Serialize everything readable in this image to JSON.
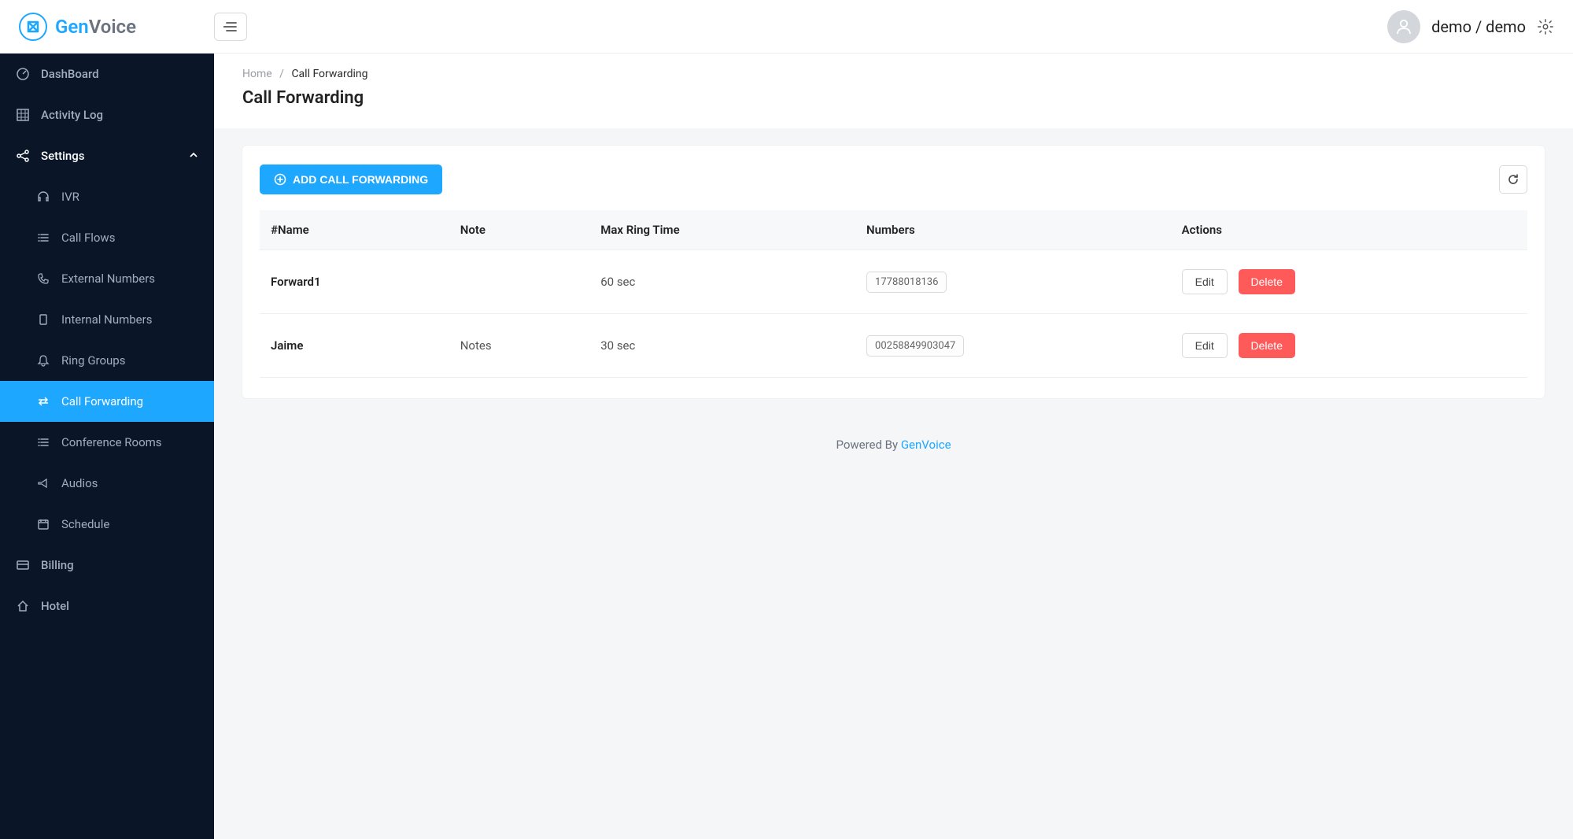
{
  "brand": {
    "part1": "Gen",
    "part2": "Voice"
  },
  "user": {
    "display": "demo / demo"
  },
  "sidebar": {
    "top": [
      {
        "label": "DashBoard",
        "icon": "dashboard"
      },
      {
        "label": "Activity Log",
        "icon": "grid"
      }
    ],
    "section": {
      "label": "Settings"
    },
    "sub": [
      {
        "label": "IVR",
        "icon": "headset"
      },
      {
        "label": "Call Flows",
        "icon": "list"
      },
      {
        "label": "External Numbers",
        "icon": "phone"
      },
      {
        "label": "Internal Numbers",
        "icon": "device"
      },
      {
        "label": "Ring Groups",
        "icon": "bell"
      },
      {
        "label": "Call Forwarding",
        "icon": "swap",
        "active": true
      },
      {
        "label": "Conference Rooms",
        "icon": "list"
      },
      {
        "label": "Audios",
        "icon": "megaphone"
      },
      {
        "label": "Schedule",
        "icon": "calendar"
      }
    ],
    "bottom": [
      {
        "label": "Billing",
        "icon": "card"
      },
      {
        "label": "Hotel",
        "icon": "home"
      }
    ]
  },
  "breadcrumb": {
    "home": "Home",
    "current": "Call Forwarding"
  },
  "page": {
    "title": "Call Forwarding"
  },
  "actions": {
    "add": "ADD CALL FORWARDING",
    "edit": "Edit",
    "delete": "Delete"
  },
  "table": {
    "headers": [
      "#Name",
      "Note",
      "Max Ring Time",
      "Numbers",
      "Actions"
    ],
    "rows": [
      {
        "name": "Forward1",
        "note": "",
        "ring": "60 sec",
        "number": "17788018136"
      },
      {
        "name": "Jaime",
        "note": "Notes",
        "ring": "30 sec",
        "number": "00258849903047"
      }
    ]
  },
  "footer": {
    "prefix": "Powered By ",
    "link": "GenVoice"
  }
}
